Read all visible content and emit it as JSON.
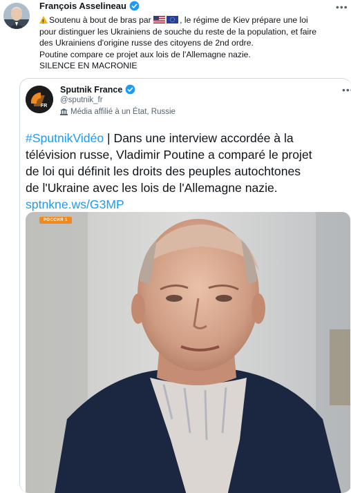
{
  "outer_tweet": {
    "author_name": "François Asselineau",
    "verified": true,
    "lines": [
      {
        "prefix_icons": [
          "warning-icon"
        ],
        "pre": "Soutenu à bout de bras par ",
        "post": ", le régime de Kiev prépare une loi"
      },
      {
        "text": "pour distinguer les Ukrainiens de souche du reste de la population, et faire"
      },
      {
        "text": "des Ukrainiens d'origine russe des citoyens de 2nd ordre."
      },
      {
        "text": "Poutine compare ce projet aux lois de l'Allemagne nazie."
      },
      {
        "text": "SILENCE EN MACRONIE"
      }
    ],
    "inline_flags": [
      "us-flag-icon",
      "eu-flag-icon"
    ]
  },
  "quoted_tweet": {
    "author_name": "Sputnik France",
    "verified": true,
    "handle": "@sputnik_fr",
    "state_label": "Média affilié à un État, Russie",
    "text_lines": [
      {
        "hashtag": "#SputnikVidéo",
        "rest": " | Dans une interview accordée à la"
      },
      {
        "text": "télévision russe, Vladimir Poutine a comparé le projet"
      },
      {
        "text": "de loi qui définit les droits des peuples autochtones"
      },
      {
        "text": "de l'Ukraine avec les lois de l'Allemagne nazie."
      },
      {
        "link": "sptnkne.ws/G3MP"
      }
    ],
    "media": {
      "broadcaster_tag": "РОССИЯ 1"
    }
  },
  "colors": {
    "link": "#1d9bf0",
    "verified": "#1d9bf0",
    "muted": "#536471",
    "border": "#cfd9de",
    "sputnik_orange": "#f08a1e"
  },
  "icons": {
    "more": "more-dots-icon",
    "verified": "verified-badge-icon",
    "state_label": "state-media-icon"
  }
}
